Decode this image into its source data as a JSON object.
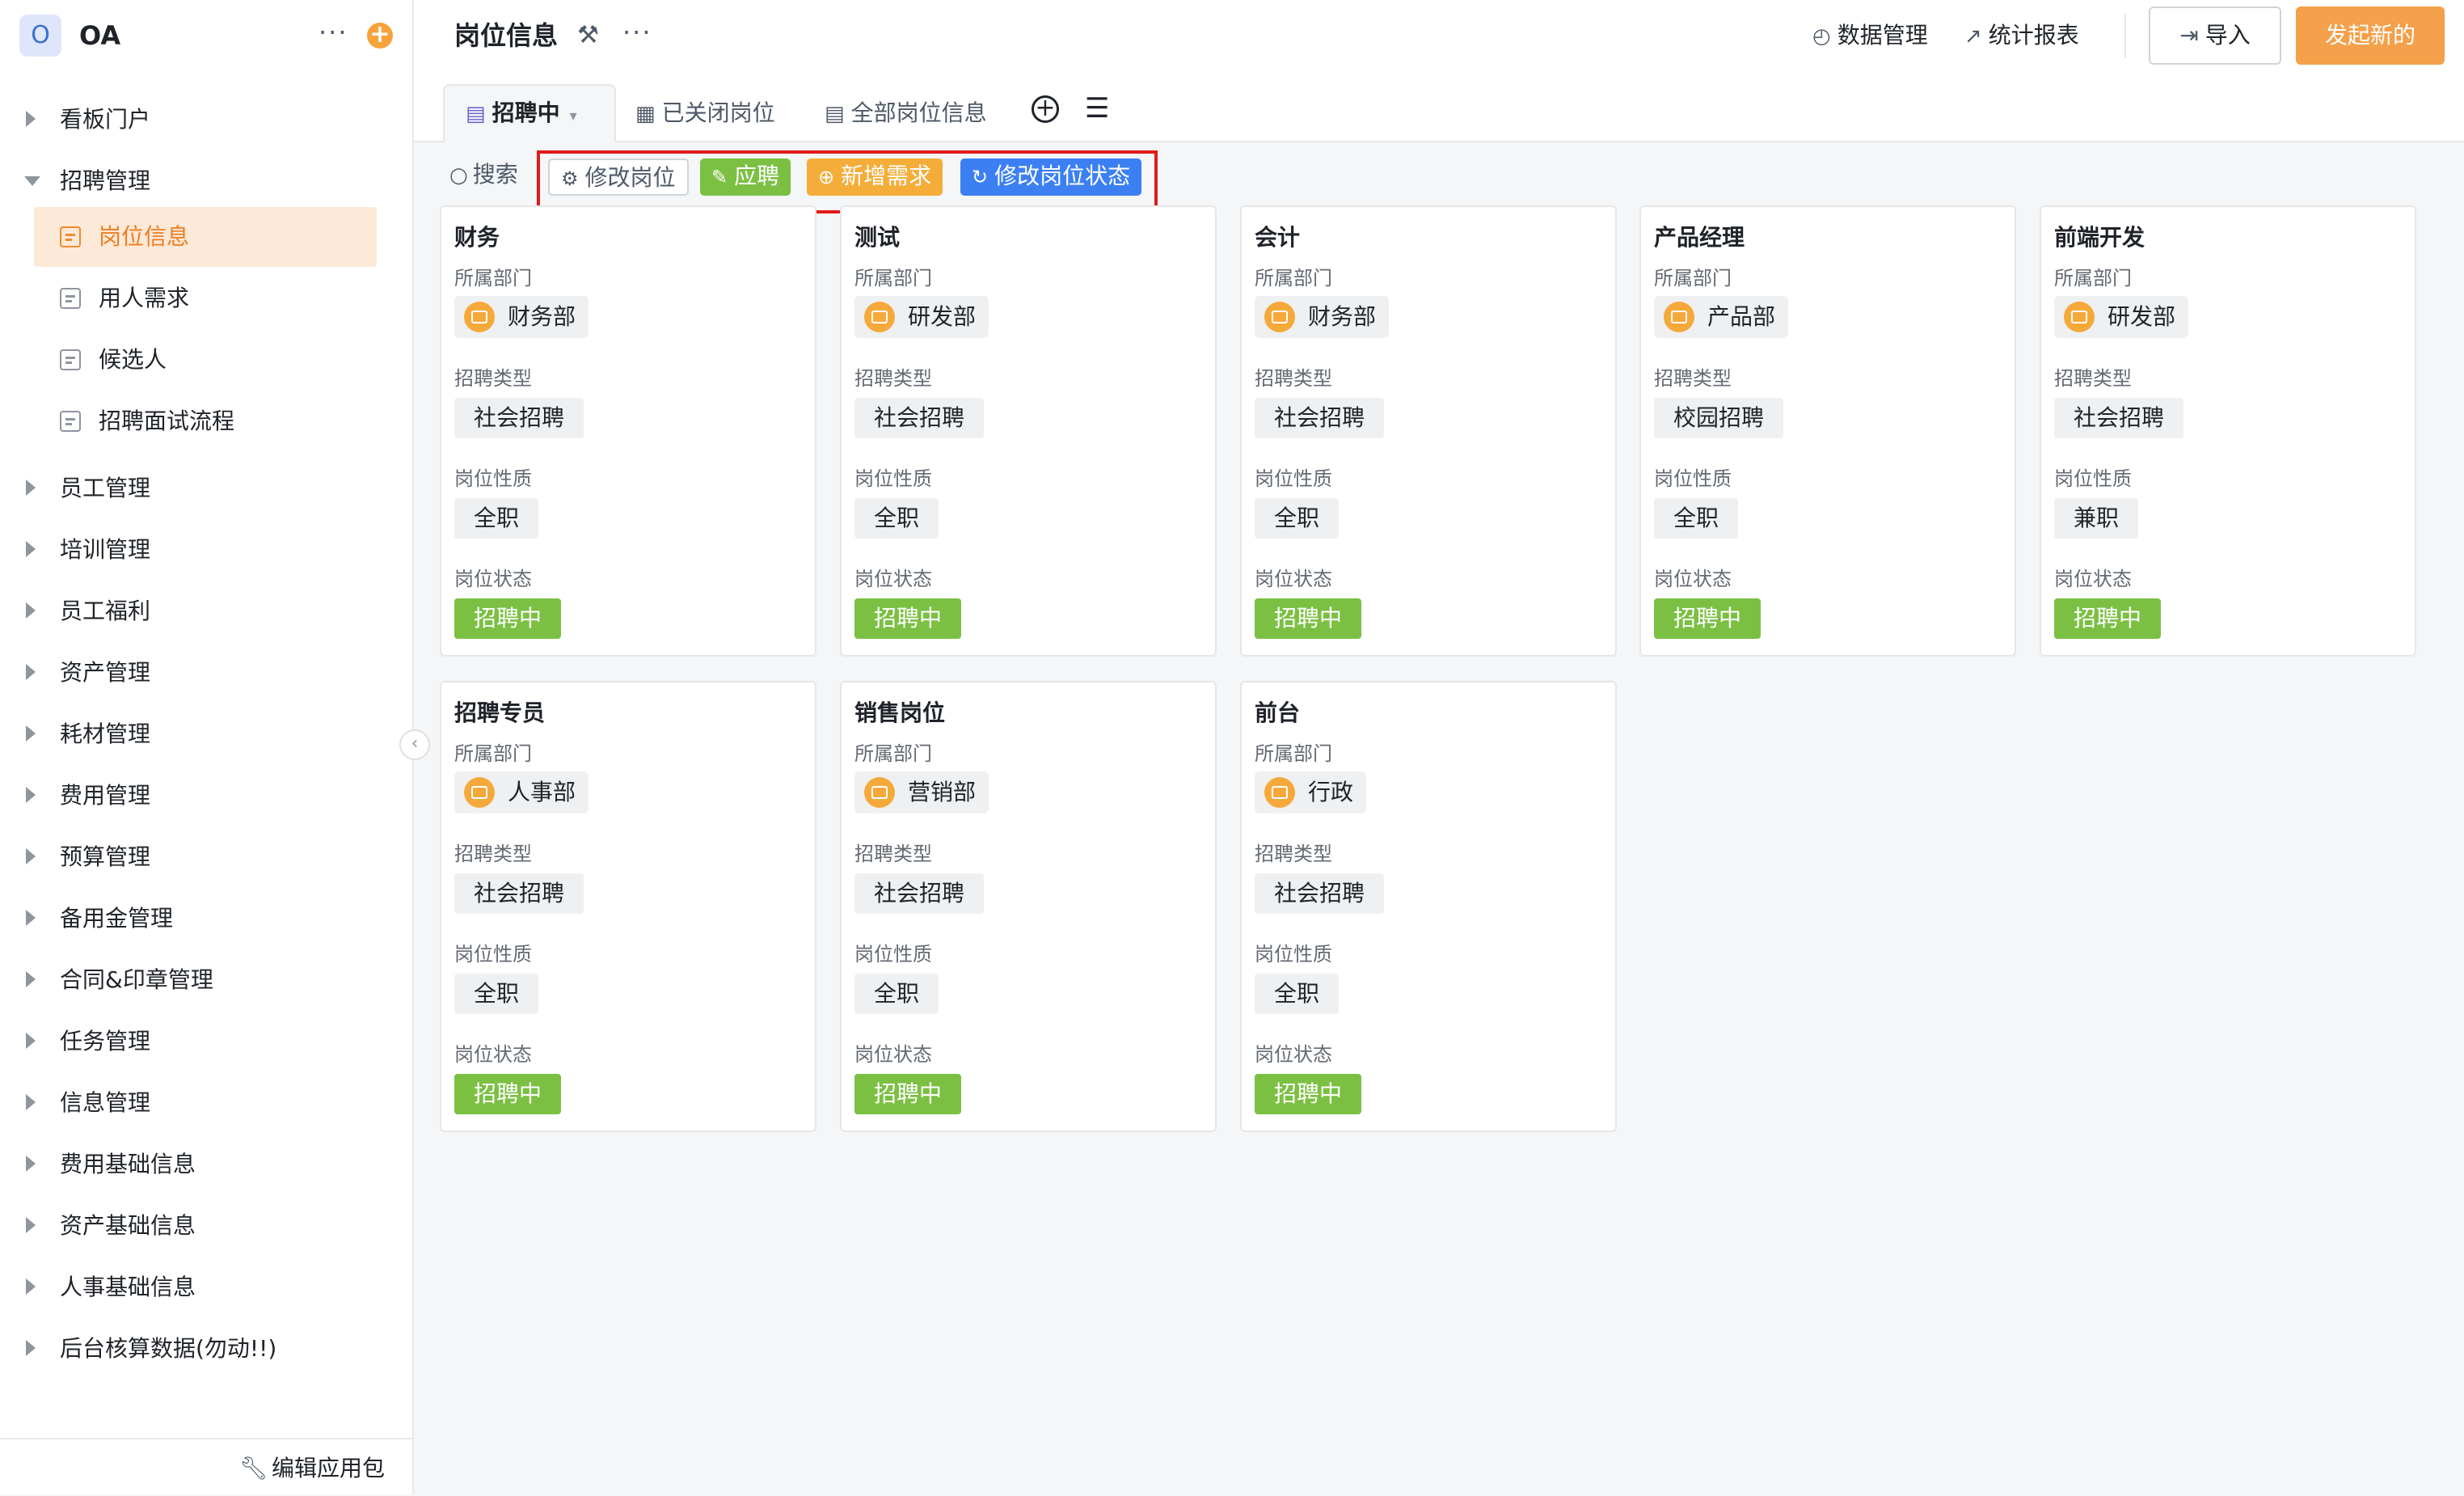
{
  "app": {
    "logo_letter": "O",
    "name": "OA"
  },
  "sidebar": {
    "more_icon": "ellipsis-icon",
    "add_icon": "plus-circle-icon",
    "items": [
      {
        "label": "看板门户",
        "expanded": false
      },
      {
        "label": "招聘管理",
        "expanded": true
      },
      {
        "label": "员工管理",
        "expanded": false
      },
      {
        "label": "培训管理",
        "expanded": false
      },
      {
        "label": "员工福利",
        "expanded": false
      },
      {
        "label": "资产管理",
        "expanded": false
      },
      {
        "label": "耗材管理",
        "expanded": false
      },
      {
        "label": "费用管理",
        "expanded": false
      },
      {
        "label": "预算管理",
        "expanded": false
      },
      {
        "label": "备用金管理",
        "expanded": false
      },
      {
        "label": "合同&印章管理",
        "expanded": false
      },
      {
        "label": "任务管理",
        "expanded": false
      },
      {
        "label": "信息管理",
        "expanded": false
      },
      {
        "label": "费用基础信息",
        "expanded": false
      },
      {
        "label": "资产基础信息",
        "expanded": false
      },
      {
        "label": "人事基础信息",
        "expanded": false
      },
      {
        "label": "后台核算数据(勿动!!)",
        "expanded": false
      }
    ],
    "sub_items": [
      {
        "label": "岗位信息",
        "active": true
      },
      {
        "label": "用人需求",
        "active": false
      },
      {
        "label": "候选人",
        "active": false
      },
      {
        "label": "招聘面试流程",
        "active": false
      }
    ],
    "footer_label": "编辑应用包"
  },
  "header": {
    "title": "岗位信息",
    "data_mgmt": "数据管理",
    "stats_report": "统计报表",
    "import_label": "导入",
    "start_label": "发起新的"
  },
  "tabs": [
    {
      "label": "招聘中",
      "active": true
    },
    {
      "label": "已关闭岗位",
      "active": false
    },
    {
      "label": "全部岗位信息",
      "active": false
    }
  ],
  "toolbar": {
    "search_label": "搜索",
    "edit_position": "修改岗位",
    "apply": "应聘",
    "add_demand": "新增需求",
    "change_status": "修改岗位状态"
  },
  "field_labels": {
    "department": "所属部门",
    "recruit_type": "招聘类型",
    "job_nature": "岗位性质",
    "job_status": "岗位状态"
  },
  "cards": [
    {
      "title": "财务",
      "department": "财务部",
      "recruit_type": "社会招聘",
      "job_nature": "全职",
      "status": "招聘中"
    },
    {
      "title": "测试",
      "department": "研发部",
      "recruit_type": "社会招聘",
      "job_nature": "全职",
      "status": "招聘中"
    },
    {
      "title": "会计",
      "department": "财务部",
      "recruit_type": "社会招聘",
      "job_nature": "全职",
      "status": "招聘中"
    },
    {
      "title": "产品经理",
      "department": "产品部",
      "recruit_type": "校园招聘",
      "job_nature": "全职",
      "status": "招聘中"
    },
    {
      "title": "前端开发",
      "department": "研发部",
      "recruit_type": "社会招聘",
      "job_nature": "兼职",
      "status": "招聘中"
    },
    {
      "title": "招聘专员",
      "department": "人事部",
      "recruit_type": "社会招聘",
      "job_nature": "全职",
      "status": "招聘中"
    },
    {
      "title": "销售岗位",
      "department": "营销部",
      "recruit_type": "社会招聘",
      "job_nature": "全职",
      "status": "招聘中"
    },
    {
      "title": "前台",
      "department": "行政",
      "recruit_type": "社会招聘",
      "job_nature": "全职",
      "status": "招聘中"
    }
  ],
  "colors": {
    "accent_orange": "#f5a04a",
    "status_green": "#7bc043",
    "primary_blue": "#3b7ff3",
    "highlight_red": "#e11a1a"
  }
}
